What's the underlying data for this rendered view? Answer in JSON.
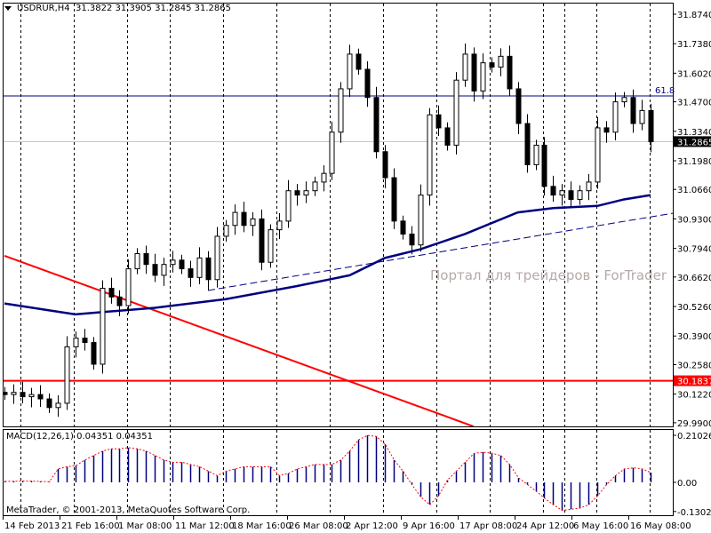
{
  "header": {
    "symbol": "USDRUR,H4",
    "ohlc": "31.3822 31.3905 31.2845 31.2865"
  },
  "watermark": "Портал для трейдеров - ForTrader",
  "copyright": "MetaTrader, © 2001-2013, MetaQuotes Software Corp.",
  "macd_title": "MACD(12,26,1) 0.04351 0.04351",
  "colors": {
    "bull_fill": "#ffffff",
    "bear_fill": "#000000",
    "ma": "#000080",
    "trend": "#ff0000",
    "hline": "#ff0000",
    "fib": "#000080",
    "macd_bar": "#000080",
    "macd_signal": "#ff0000",
    "grid": "#000000"
  },
  "chart_data": [
    {
      "type": "candlestick",
      "title": "USDRUR,H4",
      "ylim": [
        29.99,
        31.874
      ],
      "y_ticks": [
        "31.8740",
        "31.7380",
        "31.6020",
        "31.4700",
        "31.3340",
        "31.1980",
        "31.0660",
        "30.9300",
        "30.7940",
        "30.6620",
        "30.5260",
        "30.3900",
        "30.2580",
        "30.1220",
        "29.9900"
      ],
      "x_ticks": [
        "14 Feb 2013",
        "21 Feb 16:00",
        "1 Mar 08:00",
        "11 Mar 12:00",
        "18 Mar 16:00",
        "26 Mar 08:00",
        "2 Apr 12:00",
        "9 Apr 16:00",
        "17 Apr 08:00",
        "24 Apr 12:00",
        "6 May 16:00",
        "16 May 08:00"
      ],
      "grid": "vertical-dashed",
      "closes": [
        30.12,
        30.13,
        30.11,
        30.12,
        30.1,
        30.06,
        30.08,
        30.34,
        30.38,
        30.36,
        30.26,
        30.61,
        30.57,
        30.53,
        30.7,
        30.77,
        30.72,
        30.67,
        30.72,
        30.74,
        30.7,
        30.66,
        30.75,
        30.65,
        30.85,
        30.9,
        30.96,
        30.9,
        30.93,
        30.73,
        30.88,
        30.92,
        31.06,
        31.04,
        31.06,
        31.1,
        31.14,
        31.33,
        31.53,
        31.69,
        31.62,
        31.49,
        31.24,
        31.12,
        30.92,
        30.86,
        30.81,
        31.04,
        31.41,
        31.35,
        31.27,
        31.57,
        31.69,
        31.52,
        31.65,
        31.63,
        31.68,
        31.53,
        31.37,
        31.18,
        31.27,
        31.08,
        31.04,
        31.06,
        31.02,
        31.06,
        31.1,
        31.35,
        31.33,
        31.47,
        31.49,
        31.37,
        31.43,
        31.2865
      ],
      "moving_average": [
        [
          0,
          30.54
        ],
        [
          8,
          30.49
        ],
        [
          17,
          30.52
        ],
        [
          25,
          30.56
        ],
        [
          33,
          30.62
        ],
        [
          39,
          30.67
        ],
        [
          43,
          30.75
        ],
        [
          47,
          30.79
        ],
        [
          52,
          30.86
        ],
        [
          58,
          30.96
        ],
        [
          62,
          30.98
        ],
        [
          67,
          30.99
        ],
        [
          70,
          31.02
        ],
        [
          73,
          31.04
        ]
      ],
      "trendline_down": {
        "start": [
          0,
          30.76
        ],
        "end": [
          53,
          29.973
        ]
      },
      "trendline_up_dashed": {
        "start": [
          23,
          30.6
        ],
        "end": [
          75.5,
          30.956
        ]
      },
      "horizontal_line": {
        "price": 30.1837,
        "label": "30.1837"
      },
      "fib_level": {
        "price": 31.497,
        "label": "61.8"
      },
      "current_price": {
        "price": 31.2865,
        "label": "31.2865"
      }
    },
    {
      "type": "bar",
      "title": "MACD(12,26,1)",
      "ylim": [
        -0.13021,
        0.21026
      ],
      "y_ticks": [
        "0.21026",
        "0.00",
        "-0.13021"
      ],
      "values": [
        0.005,
        0.005,
        0.006,
        0.006,
        0.004,
        0.003,
        0.06,
        0.07,
        0.075,
        0.1,
        0.12,
        0.14,
        0.15,
        0.15,
        0.155,
        0.15,
        0.14,
        0.12,
        0.1,
        0.09,
        0.09,
        0.08,
        0.07,
        0.05,
        0.03,
        0.05,
        0.06,
        0.07,
        0.07,
        0.07,
        0.07,
        0.03,
        0.04,
        0.06,
        0.07,
        0.08,
        0.08,
        0.08,
        0.1,
        0.14,
        0.19,
        0.21,
        0.205,
        0.17,
        0.1,
        0.05,
        -0.01,
        -0.065,
        -0.1,
        -0.06,
        0.01,
        0.05,
        0.09,
        0.13,
        0.135,
        0.13,
        0.12,
        0.08,
        0.02,
        -0.01,
        -0.04,
        -0.07,
        -0.1,
        -0.125,
        -0.12,
        -0.115,
        -0.1,
        -0.06,
        -0.01,
        0.03,
        0.06,
        0.065,
        0.06,
        0.0435
      ]
    }
  ]
}
